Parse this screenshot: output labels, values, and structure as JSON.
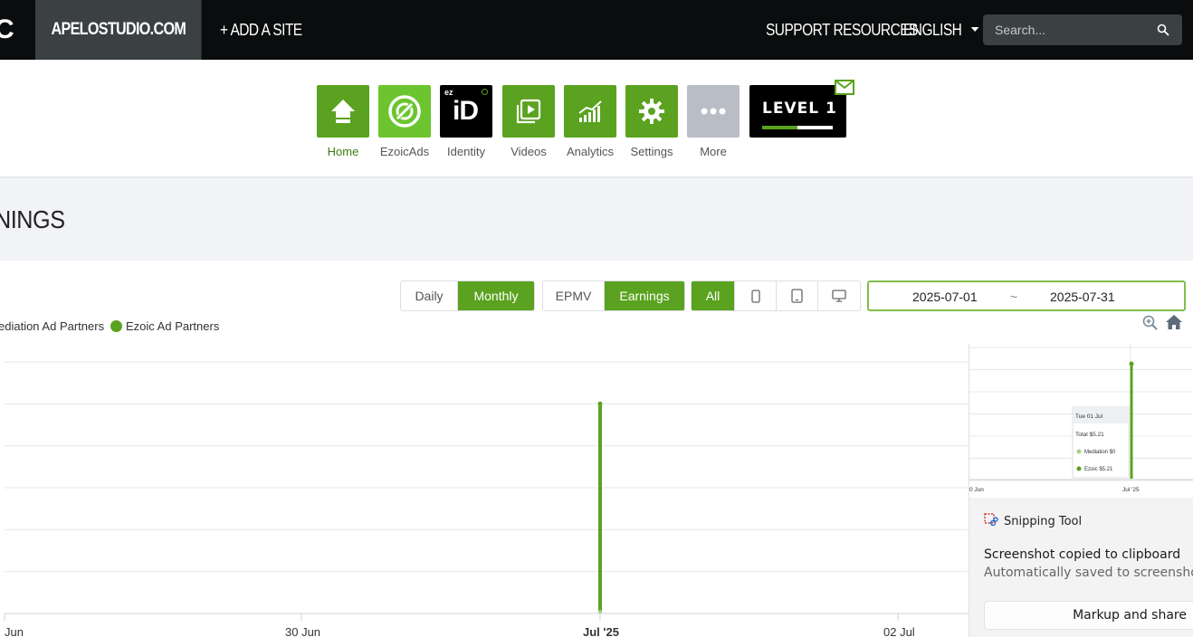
{
  "nav": {
    "logo_fragment": "C",
    "site": "APELOSTUDIO.COM",
    "add_site": "+ ADD A SITE",
    "support": "SUPPORT RESOURCES",
    "language": "ENGLISH",
    "search_placeholder": "Search..."
  },
  "apps": [
    {
      "label": "Home",
      "icon": "home-icon",
      "active": true
    },
    {
      "label": "EzoicAds",
      "icon": "ezoicads-icon"
    },
    {
      "label": "Identity",
      "icon": "identity-icon",
      "badge": "ez",
      "text": "iD"
    },
    {
      "label": "Videos",
      "icon": "videos-icon"
    },
    {
      "label": "Analytics",
      "icon": "analytics-icon"
    },
    {
      "label": "Settings",
      "icon": "settings-icon"
    },
    {
      "label": "More",
      "icon": "more-icon"
    }
  ],
  "level": {
    "label": "LEVEL 1",
    "progress": 0.5
  },
  "page_title": "NINGS",
  "controls": {
    "period": [
      "Daily",
      "Monthly"
    ],
    "period_selected": "Monthly",
    "metric": [
      "EPMV",
      "Earnings"
    ],
    "metric_selected": "Earnings",
    "device": [
      "All",
      "mobile-icon",
      "tablet-icon",
      "desktop-icon"
    ],
    "device_selected": "All",
    "date_from": "2025-07-01",
    "date_sep": "~",
    "date_to": "2025-07-31"
  },
  "legend": [
    "ediation Ad Partners",
    "Ezoic Ad Partners"
  ],
  "colors": {
    "accent": "#5aa21f",
    "nav_bg": "#0a0c0d",
    "tab_bg": "#3b4043",
    "mediation": "#a6cf8a"
  },
  "chart_data": {
    "type": "bar",
    "categories": [
      "Jun",
      "30 Jun",
      "Jul '25",
      "02 Jul"
    ],
    "series": [
      {
        "name": "Mediation Ad Partners",
        "values": [
          0,
          0,
          0,
          0
        ]
      },
      {
        "name": "Ezoic Ad Partners",
        "values": [
          0,
          0,
          5.21,
          0
        ]
      }
    ],
    "xlabel": "",
    "ylabel": "",
    "grid": true,
    "legend_position": "top-left"
  },
  "snipping_tool": {
    "app": "Snipping Tool",
    "message": "Screenshot copied to clipboard",
    "sub": "Automatically saved to screenshots f",
    "button": "Markup and share",
    "thumb_tooltip": {
      "date": "Tue 01 Jul",
      "total": "Total  $5.21",
      "mediation": "Mediation  $0",
      "ezoic": "Ezoic  $5.21"
    },
    "thumb_ticks": [
      "0 Jun",
      "Jul '25"
    ]
  }
}
